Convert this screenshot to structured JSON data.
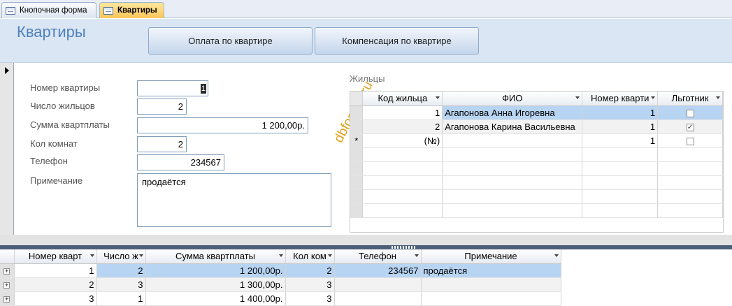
{
  "tabs": [
    {
      "label": "Кнопочная форма",
      "active": false
    },
    {
      "label": "Квартиры",
      "active": true
    }
  ],
  "form": {
    "title": "Квартиры",
    "buttons": {
      "pay_label": "Оплата по квартире",
      "comp_label": "Компенсация по квартире"
    },
    "fields": {
      "flat_no": {
        "label": "Номер квартиры",
        "value": "1"
      },
      "residents": {
        "label": "Число жильцов",
        "value": "2"
      },
      "rent": {
        "label": "Сумма квартплаты",
        "value": "1 200,00р."
      },
      "rooms": {
        "label": "Кол комнат",
        "value": "2"
      },
      "phone": {
        "label": "Телефон",
        "value": "234567"
      },
      "note": {
        "label": "Примечание",
        "value": "продаётся"
      }
    },
    "watermark": "dbforyou.ru"
  },
  "subform": {
    "label": "Жильцы",
    "columns": [
      "Код жильца",
      "ФИО",
      "Номер кварти",
      "Льготник"
    ],
    "rows": [
      {
        "id": "1",
        "fio": "Агапонова Анна Игоревна",
        "flat": "1",
        "benefit": false
      },
      {
        "id": "2",
        "fio": "Агапонова Карина Васильевна",
        "flat": "1",
        "benefit": true
      }
    ],
    "new_row": {
      "marker": "*",
      "id": "(№)",
      "flat": "1",
      "benefit": false
    }
  },
  "datasheet": {
    "columns": [
      "Номер кварт",
      "Число ж",
      "Сумма квартплаты",
      "Кол ком",
      "Телефон",
      "Примечание"
    ],
    "rows": [
      {
        "flat": "1",
        "residents": "2",
        "rent": "1 200,00р.",
        "rooms": "2",
        "phone": "234567",
        "note": "продаётся"
      },
      {
        "flat": "2",
        "residents": "3",
        "rent": "1 300,00р.",
        "rooms": "3",
        "phone": "",
        "note": ""
      },
      {
        "flat": "3",
        "residents": "1",
        "rent": "1 400,00р.",
        "rooms": "3",
        "phone": "",
        "note": ""
      }
    ]
  }
}
